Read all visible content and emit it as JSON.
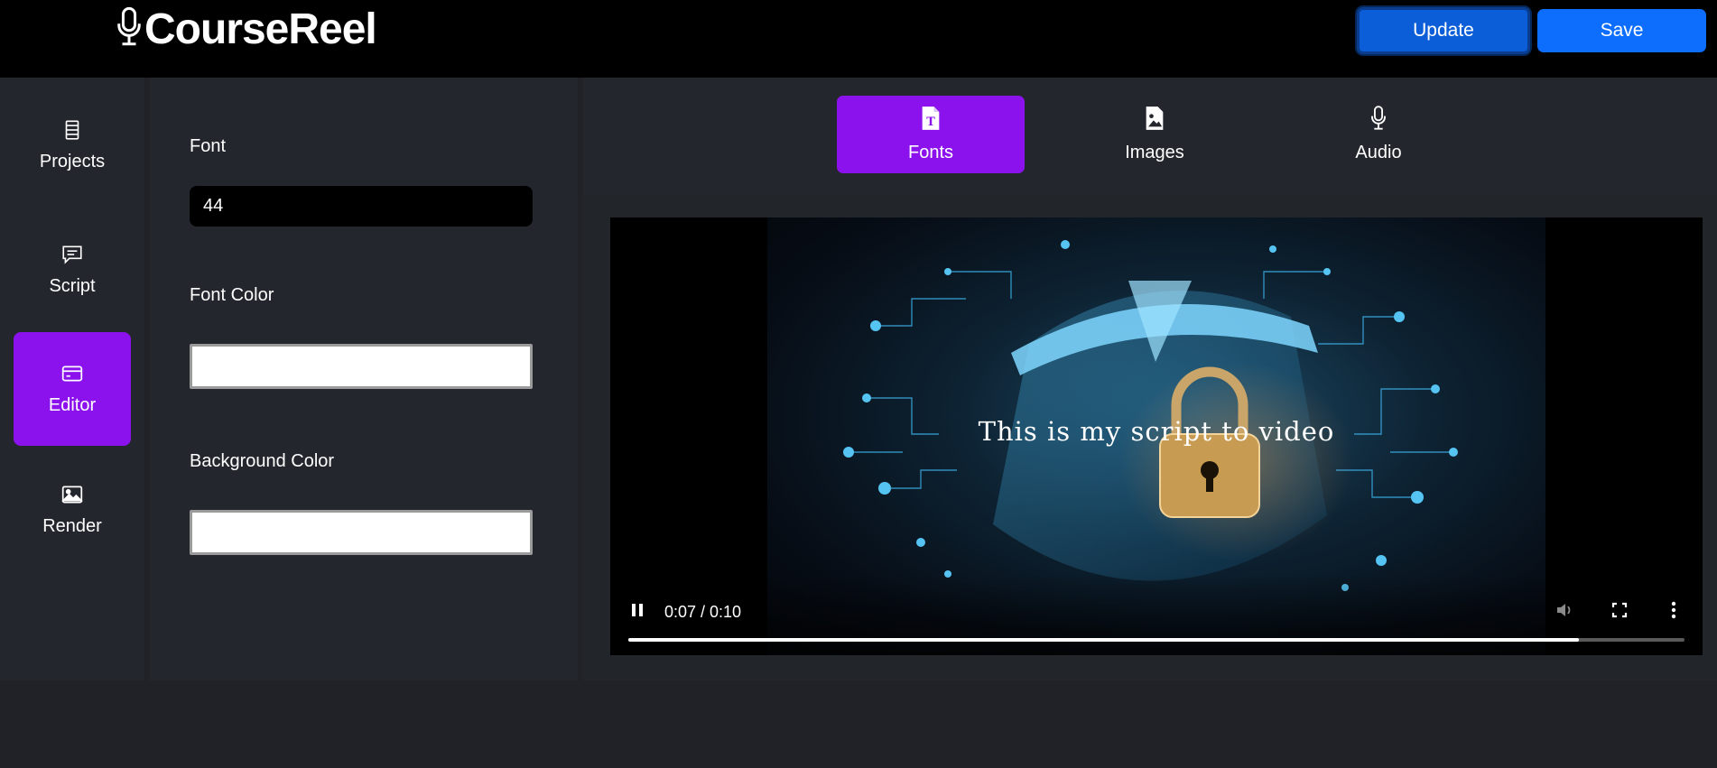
{
  "app": {
    "title": "CourseReel"
  },
  "header": {
    "update_label": "Update",
    "save_label": "Save"
  },
  "sidebar": {
    "items": [
      {
        "label": "Projects",
        "icon": "list-icon",
        "active": false
      },
      {
        "label": "Script",
        "icon": "chat-icon",
        "active": false
      },
      {
        "label": "Editor",
        "icon": "card-icon",
        "active": true
      },
      {
        "label": "Render",
        "icon": "image-icon",
        "active": false
      }
    ]
  },
  "properties": {
    "font_label": "Font",
    "font_value": "44",
    "font_color_label": "Font Color",
    "font_color_value": "#ffffff",
    "background_color_label": "Background Color",
    "background_color_value": "#ffffff"
  },
  "tabs": [
    {
      "label": "Fonts",
      "icon": "file-font-icon",
      "active": true
    },
    {
      "label": "Images",
      "icon": "file-image-icon",
      "active": false
    },
    {
      "label": "Audio",
      "icon": "microphone-icon",
      "active": false
    }
  ],
  "player": {
    "caption": "This is my script to video",
    "time": "0:07 / 0:10",
    "progress": 0.9,
    "state": "playing",
    "muted": true
  },
  "colors": {
    "accent": "#8b12ec",
    "primary": "#0d6efd",
    "topbar": "#000000",
    "panel": "#23262c"
  }
}
